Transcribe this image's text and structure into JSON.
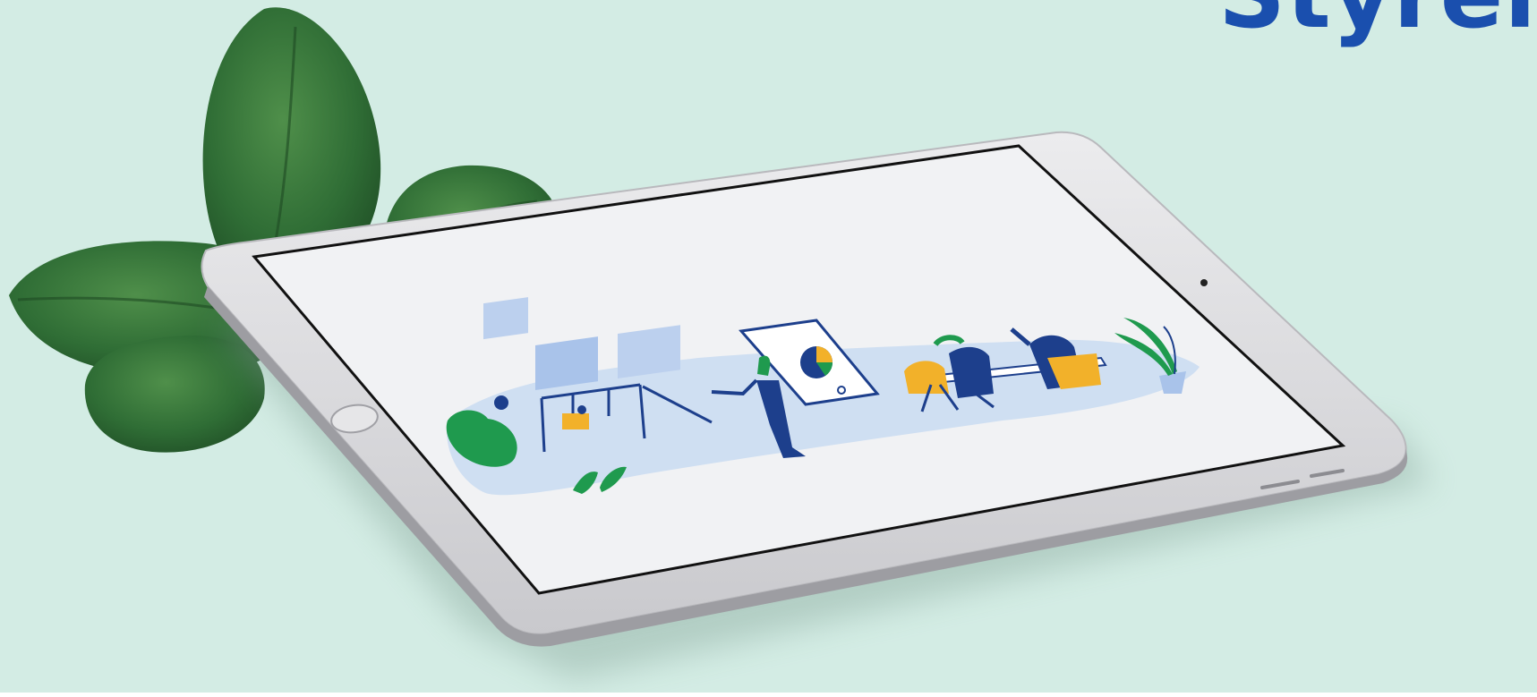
{
  "brand": {
    "wordmark": "Styrel",
    "color": "#1a4fae"
  },
  "colors": {
    "background": "#d3ece4",
    "tablet_frame": "#d9d9dc",
    "screen": "#f1f2f4",
    "leaf": "#2f6d35",
    "illustration_blue": "#1d3f8c",
    "illustration_light_blue": "#cfdff2",
    "illustration_green": "#1f9a4e",
    "illustration_yellow": "#f2b12a"
  },
  "icons": [
    "leaf-icon",
    "home-button-icon",
    "camera-icon",
    "pie-chart-icon",
    "plant-icon"
  ]
}
